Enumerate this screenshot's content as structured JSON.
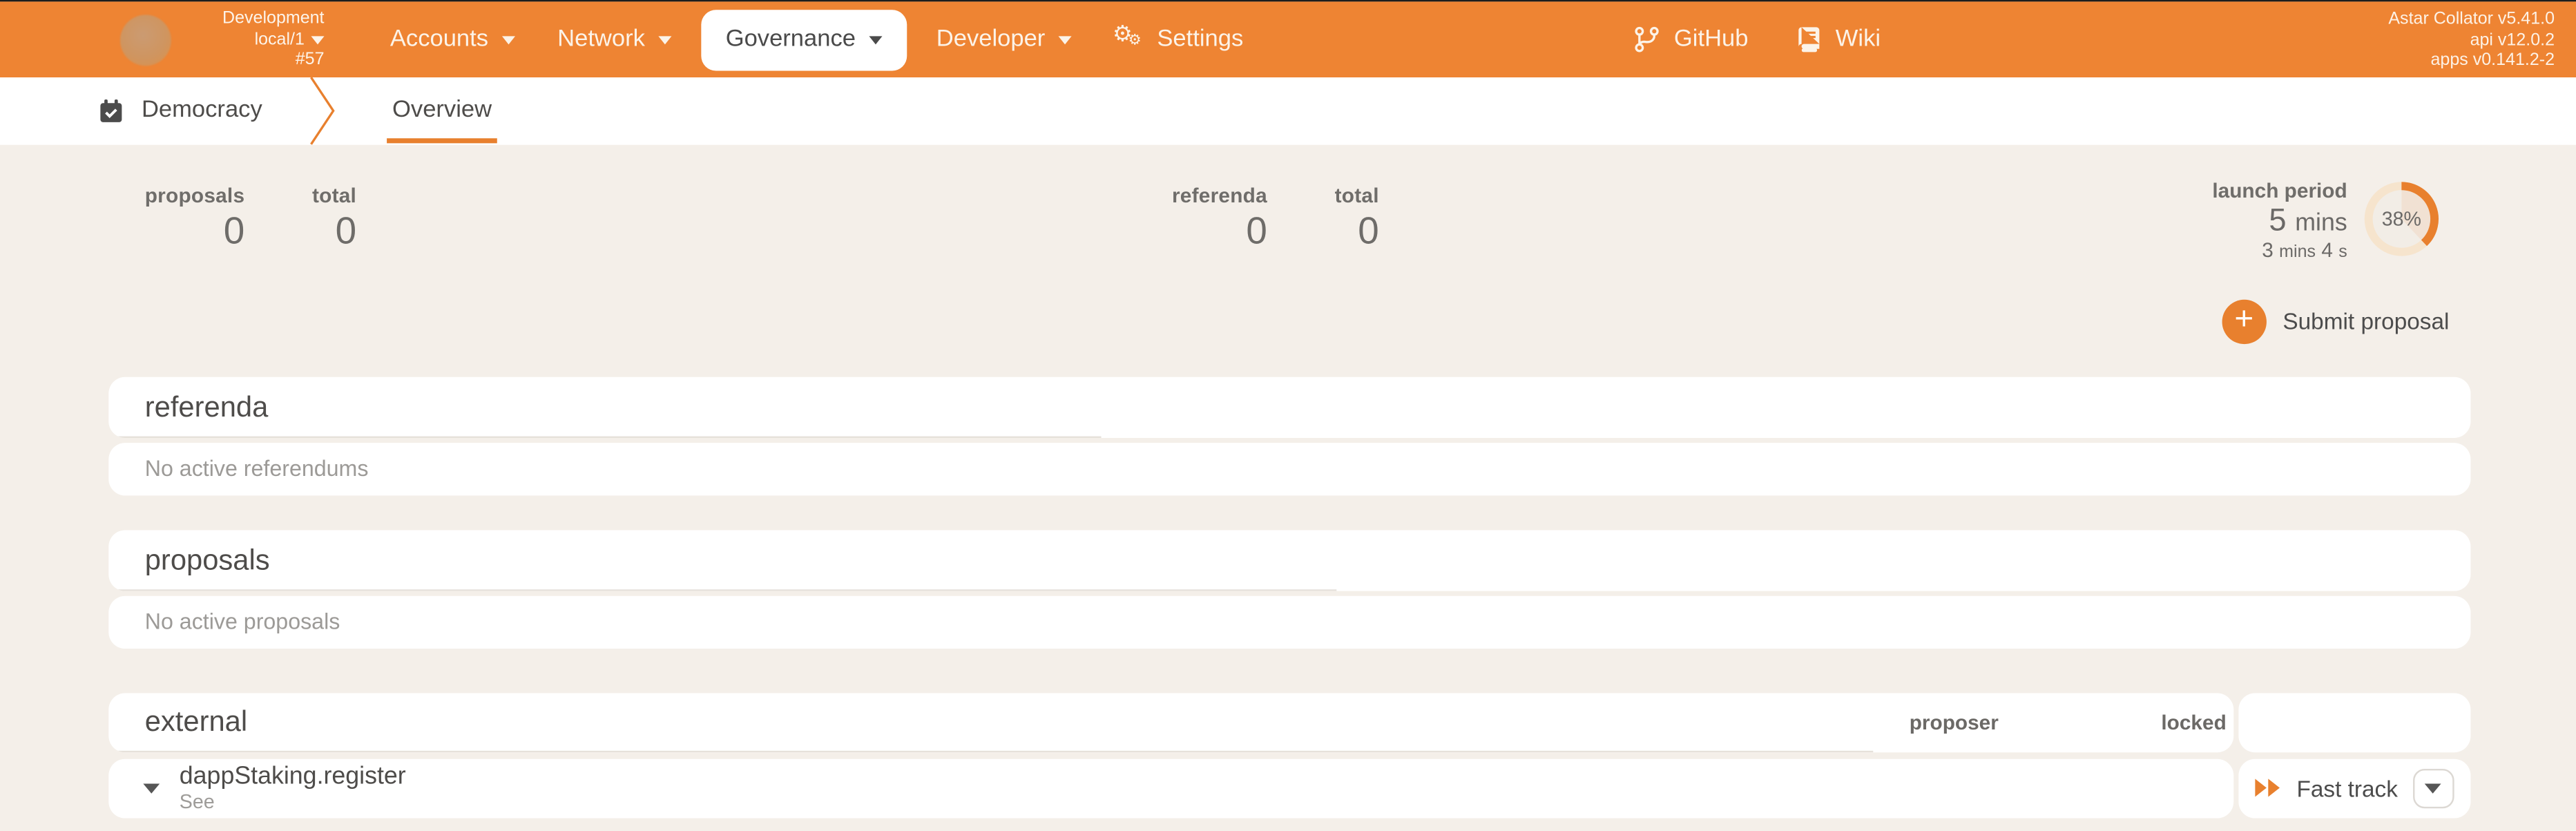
{
  "header": {
    "network": {
      "chain": "Development",
      "node": "local/1",
      "best_block": "#57"
    },
    "nav": [
      {
        "label": "Accounts"
      },
      {
        "label": "Network"
      },
      {
        "label": "Governance",
        "active": true
      },
      {
        "label": "Developer"
      },
      {
        "label": "Settings"
      }
    ],
    "links": {
      "github": "GitHub",
      "wiki": "Wiki"
    },
    "version": {
      "node": "Astar Collator v5.41.0",
      "api": "api v12.0.2",
      "apps": "apps v0.141.2-2"
    }
  },
  "tabbar": {
    "section": "Democracy",
    "active_tab": "Overview"
  },
  "summary": {
    "stats": [
      {
        "label": "proposals",
        "value": "0"
      },
      {
        "label": "total",
        "value": "0"
      },
      {
        "label": "referenda",
        "value": "0"
      },
      {
        "label": "total",
        "value": "0"
      }
    ],
    "launch_period": {
      "label": "launch period",
      "value_num": "5",
      "value_unit": "mins",
      "remaining": [
        {
          "v": "3",
          "u": "mins"
        },
        {
          "v": "4",
          "u": "s"
        }
      ],
      "progress_pct": 38,
      "progress_text": "38%"
    }
  },
  "actions": {
    "submit_proposal": "Submit proposal"
  },
  "sections": {
    "referenda": {
      "title": "referenda",
      "empty": "No active referendums"
    },
    "proposals": {
      "title": "proposals",
      "empty": "No active proposals"
    },
    "external": {
      "title": "external",
      "columns": {
        "proposer": "proposer",
        "locked": "locked"
      },
      "row": {
        "method": "dappStaking.register",
        "note": "See",
        "action": "Fast track"
      }
    }
  },
  "colors": {
    "header": "#ee8433",
    "accent": "#e8802e",
    "background": "#f4efe9"
  }
}
